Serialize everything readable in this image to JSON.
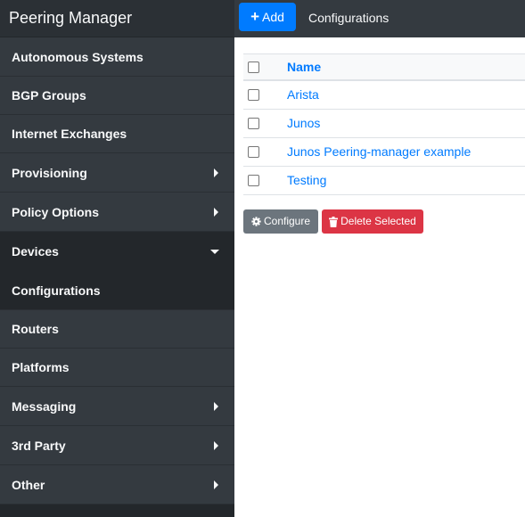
{
  "app": {
    "title": "Peering Manager"
  },
  "sidebar": {
    "items": [
      {
        "label": "Autonomous Systems",
        "expandable": false
      },
      {
        "label": "BGP Groups",
        "expandable": false
      },
      {
        "label": "Internet Exchanges",
        "expandable": false
      },
      {
        "label": "Provisioning",
        "expandable": true,
        "expanded": false
      },
      {
        "label": "Policy Options",
        "expandable": true,
        "expanded": false
      },
      {
        "label": "Devices",
        "expandable": true,
        "expanded": true
      },
      {
        "label": "Configurations",
        "expandable": false,
        "child_of": "Devices",
        "selected": true
      },
      {
        "label": "Routers",
        "expandable": false
      },
      {
        "label": "Platforms",
        "expandable": false
      },
      {
        "label": "Messaging",
        "expandable": true,
        "expanded": false
      },
      {
        "label": "3rd Party",
        "expandable": true,
        "expanded": false
      },
      {
        "label": "Other",
        "expandable": true,
        "expanded": false
      }
    ]
  },
  "toolbar": {
    "add_label": "Add",
    "page_title": "Configurations"
  },
  "table": {
    "column_name": "Name",
    "rows": [
      {
        "name": "Arista"
      },
      {
        "name": "Junos"
      },
      {
        "name": "Junos Peering-manager example"
      },
      {
        "name": "Testing"
      }
    ]
  },
  "actions": {
    "configure_label": "Configure",
    "delete_label": "Delete Selected"
  },
  "colors": {
    "sidebar_bg": "#343a40",
    "primary": "#007bff",
    "secondary": "#6c757d",
    "danger": "#dc3545"
  },
  "icons": {
    "add": "plus-icon",
    "configure": "gear-icon",
    "delete": "trash-icon",
    "collapsed": "caret-right-icon",
    "expanded": "caret-down-icon"
  }
}
